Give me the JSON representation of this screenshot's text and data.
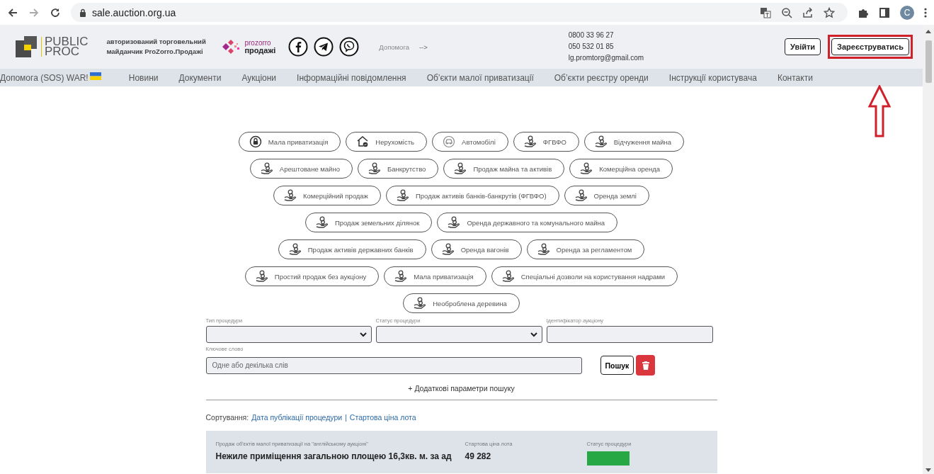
{
  "browser": {
    "url": "sale.auction.org.ua",
    "profile_initial": "C"
  },
  "header": {
    "logo_top": "PUBLIC",
    "logo_bottom": "PROC",
    "tagline": "авторизований торговельний майданчик ProZorro.Продажі",
    "partner_top": "prozorro",
    "partner_bottom": "продажі",
    "help": "Допомога",
    "help_arrow": "-->",
    "phones": [
      "0800 33 96 27",
      "050 532 01 85"
    ],
    "email": "lg.promtorg@gmail.com",
    "buttons": [
      {
        "label": "Увійти",
        "highlighted": false
      },
      {
        "label": "Зареєструватись",
        "highlighted": true
      }
    ]
  },
  "nav": [
    {
      "label": "Допомога (SOS) WAR!",
      "flag": true
    },
    {
      "label": "Новини",
      "flag": false
    },
    {
      "label": "Документи",
      "flag": false
    },
    {
      "label": "Аукціони",
      "flag": false
    },
    {
      "label": "Інформаційні повідомлення",
      "flag": false
    },
    {
      "label": "Об’єкти малої приватизації",
      "flag": false
    },
    {
      "label": "Об’єкти реєстру оренди",
      "flag": false
    },
    {
      "label": "Інструкції користувача",
      "flag": false
    },
    {
      "label": "Контакти",
      "flag": false
    }
  ],
  "category_rows": [
    [
      {
        "label": "Мала приватизація",
        "kind": "lock"
      },
      {
        "label": "Нерухомість",
        "kind": "house"
      },
      {
        "label": "Автомобілі",
        "kind": "car"
      },
      {
        "label": "ФГВФО",
        "kind": "coins"
      },
      {
        "label": "Відчуження майна",
        "kind": "coins"
      }
    ],
    [
      {
        "label": "Арештоване майно",
        "kind": "coins"
      },
      {
        "label": "Банкрутство",
        "kind": "coins"
      },
      {
        "label": "Продаж майна та активів",
        "kind": "coins"
      },
      {
        "label": "Комерційна оренда",
        "kind": "coins"
      }
    ],
    [
      {
        "label": "Комерційний продаж",
        "kind": "coins"
      },
      {
        "label": "Продаж активів банків-банкрутів (ФГВФО)",
        "kind": "coins"
      },
      {
        "label": "Оренда землі",
        "kind": "coins"
      }
    ],
    [
      {
        "label": "Продаж земельних ділянок",
        "kind": "coins"
      },
      {
        "label": "Оренда державного та комунального майна",
        "kind": "coins"
      }
    ],
    [
      {
        "label": "Продаж активів державних банків",
        "kind": "coins"
      },
      {
        "label": "Оренда вагонів",
        "kind": "coins"
      },
      {
        "label": "Оренда за регламентом",
        "kind": "coins"
      }
    ],
    [
      {
        "label": "Простий продаж без аукціону",
        "kind": "coins"
      },
      {
        "label": "Мала приватизація",
        "kind": "coins"
      },
      {
        "label": "Спеціальні дозволи на користування надрами",
        "kind": "coins"
      }
    ],
    [
      {
        "label": "Необроблена деревина",
        "kind": "coins"
      }
    ]
  ],
  "filters": {
    "fields": [
      {
        "label": "Тип процедури",
        "kind": "select"
      },
      {
        "label": "Статус процедури",
        "kind": "select"
      },
      {
        "label": "Ідентифікатор аукціону",
        "kind": "text"
      }
    ],
    "keyword_label": "Ключове слово",
    "keyword_placeholder": "Одне або декілька слів",
    "search_button": "Пошук",
    "more": "+ Додаткові параметри пошуку"
  },
  "sorting": {
    "label": "Сортування:",
    "options": [
      "Дата публікації процедури",
      "Стартова ціна лота"
    ],
    "separator": "|"
  },
  "lot": {
    "columns": [
      "Продаж об'єктів малої приватизації на \"англійському аукціоні\"",
      "Стартова ціна лота",
      "Статус процедури"
    ],
    "title": "Нежиле приміщення загальною площею 16,3кв. м. за ад",
    "price": "49 282"
  }
}
